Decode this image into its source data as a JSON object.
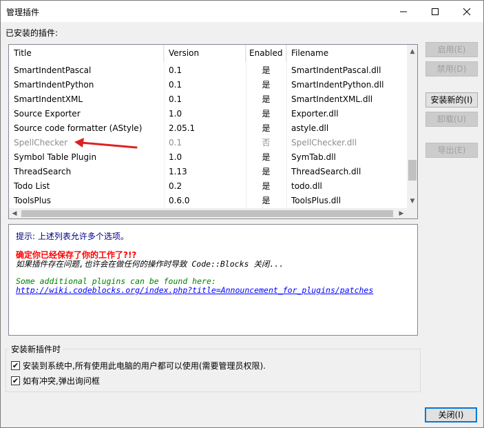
{
  "window": {
    "title": "管理插件"
  },
  "installed_label": "已安装的插件:",
  "columns": [
    "Title",
    "Version",
    "Enabled",
    "Filename"
  ],
  "rows": [
    {
      "title": "SmartIndentPascal",
      "version": "0.1",
      "enabled": "是",
      "filename": "SmartIndentPascal.dll",
      "disabled": false
    },
    {
      "title": "SmartIndentPython",
      "version": "0.1",
      "enabled": "是",
      "filename": "SmartIndentPython.dll",
      "disabled": false
    },
    {
      "title": "SmartIndentXML",
      "version": "0.1",
      "enabled": "是",
      "filename": "SmartIndentXML.dll",
      "disabled": false
    },
    {
      "title": "Source Exporter",
      "version": "1.0",
      "enabled": "是",
      "filename": "Exporter.dll",
      "disabled": false
    },
    {
      "title": "Source code formatter (AStyle)",
      "version": "2.05.1",
      "enabled": "是",
      "filename": "astyle.dll",
      "disabled": false
    },
    {
      "title": "SpellChecker",
      "version": "0.1",
      "enabled": "否",
      "filename": "SpellChecker.dll",
      "disabled": true
    },
    {
      "title": "Symbol Table Plugin",
      "version": "1.0",
      "enabled": "是",
      "filename": "SymTab.dll",
      "disabled": false
    },
    {
      "title": "ThreadSearch",
      "version": "1.13",
      "enabled": "是",
      "filename": "ThreadSearch.dll",
      "disabled": false
    },
    {
      "title": "Todo List",
      "version": "0.2",
      "enabled": "是",
      "filename": "todo.dll",
      "disabled": false
    },
    {
      "title": "ToolsPlus",
      "version": "0.6.0",
      "enabled": "是",
      "filename": "ToolsPlus.dll",
      "disabled": false
    }
  ],
  "info": {
    "tip": "提示: 上述列表允许多个选项。",
    "warning": "确定你已经保存了你的工作了?!?",
    "crash_note": "如果插件存在问题,也许会在做任何的操作时导致 Code::Blocks 关闭...",
    "more_plugins": "Some additional plugins can be found here:",
    "link": "http://wiki.codeblocks.org/index.php?title=Announcement_for_plugins/patches"
  },
  "install_options": {
    "label": "安装新插件时",
    "system_wide": {
      "label": "安装到系统中,所有使用此电脑的用户都可以使用(需要管理员权限).",
      "checked": true
    },
    "confirm_conflicts": {
      "label": "如有冲突,弹出询问框",
      "checked": true
    }
  },
  "buttons": {
    "enable": "启用(E)",
    "disable": "禁用(D)",
    "install": "安装新的(I)",
    "uninstall": "卸载(U)",
    "export": "导出(E)",
    "close": "关闭(I)"
  },
  "colors": {
    "annotation_arrow": "#e02020",
    "link": "#0000ff",
    "warning": "#ff0000",
    "tip": "#000080",
    "accent": "#0078d7"
  }
}
